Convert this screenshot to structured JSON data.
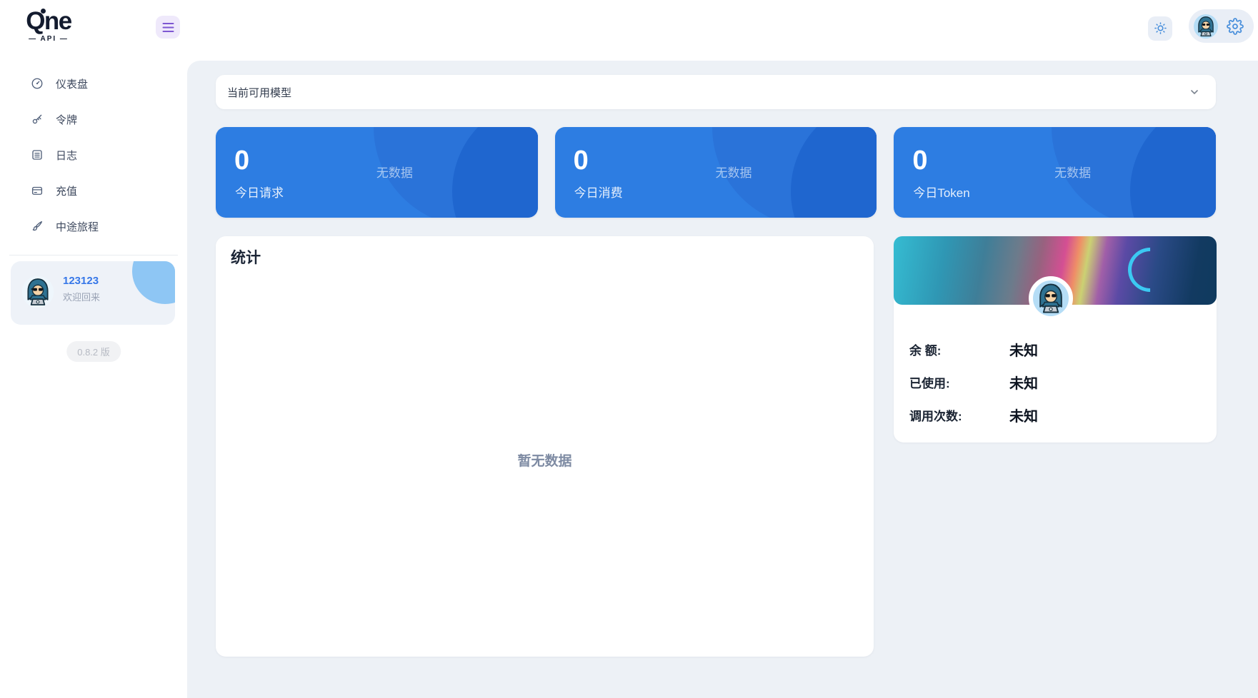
{
  "brand": {
    "name": "Qne",
    "sub": "— API —"
  },
  "sidebar": {
    "items": [
      {
        "label": "仪表盘",
        "icon": "gauge-icon"
      },
      {
        "label": "令牌",
        "icon": "key-icon"
      },
      {
        "label": "日志",
        "icon": "logs-icon"
      },
      {
        "label": "充值",
        "icon": "credit-card-icon"
      },
      {
        "label": "中途旅程",
        "icon": "paintbrush-icon"
      }
    ],
    "user": {
      "name": "123123",
      "greeting": "欢迎回来"
    },
    "version": "0.8.2 版"
  },
  "models_panel": {
    "title": "当前可用模型"
  },
  "stat_cards": [
    {
      "value": "0",
      "label": "今日请求",
      "empty": "无数据"
    },
    {
      "value": "0",
      "label": "今日消费",
      "empty": "无数据"
    },
    {
      "value": "0",
      "label": "今日Token",
      "empty": "无数据"
    }
  ],
  "stats_panel": {
    "title": "统计",
    "empty": "暂无数据"
  },
  "profile_card": {
    "rows": [
      {
        "label": "余 额:",
        "value": "未知"
      },
      {
        "label": "已使用:",
        "value": "未知"
      },
      {
        "label": "调用次数:",
        "value": "未知"
      }
    ]
  },
  "colors": {
    "primary_blue": "#2d7de2",
    "accent_purple": "#7e57d2",
    "content_bg": "#edf1f6",
    "link_blue": "#3677e8"
  }
}
